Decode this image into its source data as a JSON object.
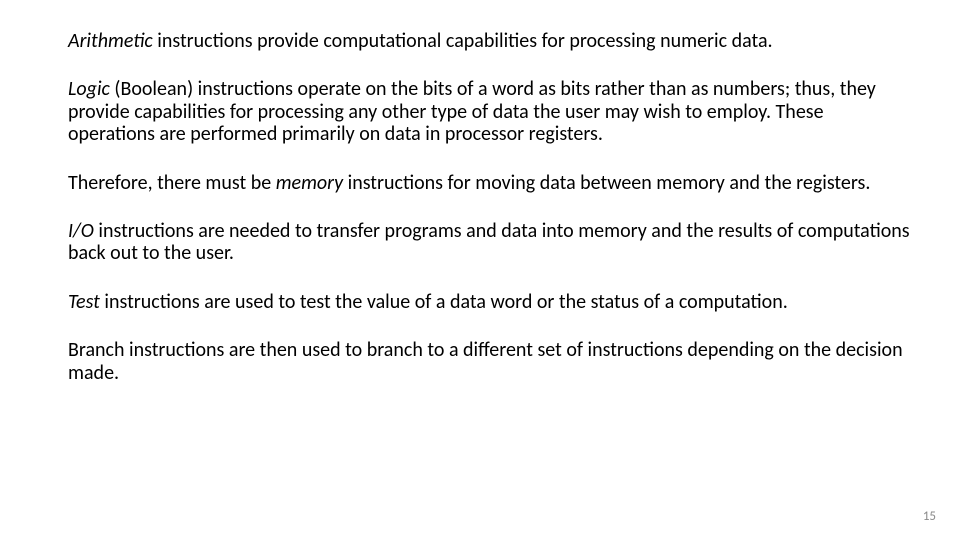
{
  "paragraphs": {
    "p1": {
      "lead": "Arithmetic",
      "rest": " instructions provide computational capabilities for processing numeric data."
    },
    "p2": {
      "lead": "Logic",
      "rest": " (Boolean) instructions operate on the bits of a word as bits rather than as numbers; thus, they provide capabilities for processing any other type of data the user may wish to employ. These operations are performed primarily on data in processor registers."
    },
    "p3": {
      "pre": "Therefore, there must be ",
      "lead": "memory",
      "rest": " instructions for moving data between memory and the registers."
    },
    "p4": {
      "lead": "I/O",
      "rest": " instructions are needed to transfer programs and data into memory and the results of computations back out to the user."
    },
    "p5": {
      "lead": "Test",
      "rest": " instructions are used to test the value of a data word or the status of a computation."
    },
    "p6": {
      "text": "Branch instructions are then used to branch to a different set of instructions depending on the decision made."
    }
  },
  "page_number": "15"
}
